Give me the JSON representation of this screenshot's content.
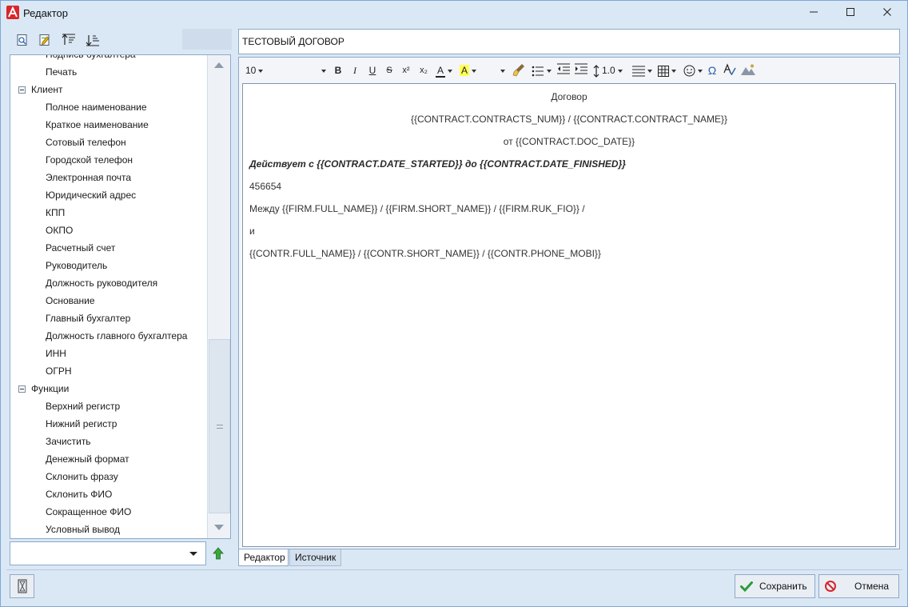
{
  "window": {
    "title": "Редактор",
    "colors": {
      "frame": "#dae8f5",
      "border": "#7ea7d6",
      "app_icon": "#d8262c"
    }
  },
  "left_toolbar": {
    "icons": [
      "preview-icon",
      "edit-icon",
      "sort-up-icon",
      "sort-down-icon"
    ]
  },
  "tree": {
    "items": [
      {
        "label": "Подпись бухгалтера",
        "level": 1
      },
      {
        "label": "Печать",
        "level": 1
      },
      {
        "label": "Клиент",
        "level": 0,
        "expanded": true
      },
      {
        "label": "Полное наименование",
        "level": 1
      },
      {
        "label": "Краткое наименование",
        "level": 1
      },
      {
        "label": "Сотовый телефон",
        "level": 1
      },
      {
        "label": "Городской телефон",
        "level": 1
      },
      {
        "label": "Электронная почта",
        "level": 1
      },
      {
        "label": "Юридический адрес",
        "level": 1
      },
      {
        "label": "КПП",
        "level": 1
      },
      {
        "label": "ОКПО",
        "level": 1
      },
      {
        "label": "Расчетный счет",
        "level": 1
      },
      {
        "label": "Руководитель",
        "level": 1
      },
      {
        "label": "Должность руководителя",
        "level": 1
      },
      {
        "label": "Основание",
        "level": 1
      },
      {
        "label": "Главный бухгалтер",
        "level": 1
      },
      {
        "label": "Должность главного бухгалтера",
        "level": 1
      },
      {
        "label": "ИНН",
        "level": 1
      },
      {
        "label": "ОГРН",
        "level": 1
      },
      {
        "label": "Функции",
        "level": 0,
        "expanded": true
      },
      {
        "label": "Верхний регистр",
        "level": 1
      },
      {
        "label": "Нижний регистр",
        "level": 1
      },
      {
        "label": "Зачистить",
        "level": 1
      },
      {
        "label": "Денежный формат",
        "level": 1
      },
      {
        "label": "Склонить фразу",
        "level": 1
      },
      {
        "label": "Склонить ФИО",
        "level": 1
      },
      {
        "label": "Сокращенное ФИО",
        "level": 1
      },
      {
        "label": "Условный вывод",
        "level": 1
      }
    ]
  },
  "combo": {
    "value": ""
  },
  "document_title": {
    "value": "ТЕСТОВЫЙ ДОГОВОР"
  },
  "toolbar": {
    "font_size": "10",
    "bold": "B",
    "italic": "I",
    "underline": "U",
    "strike": "S",
    "superscript": "x²",
    "subscript": "x₂",
    "font_color": "A",
    "highlight": "A",
    "line_spacing": "1.0",
    "omega": "Ω"
  },
  "document": {
    "lines": [
      {
        "text": "Договор",
        "style": "center"
      },
      {
        "text": "{{CONTRACT.CONTRACTS_NUM}} / {{CONTRACT.CONTRACT_NAME}}",
        "style": "center"
      },
      {
        "text": "от {{CONTRACT.DOC_DATE}}",
        "style": "center"
      },
      {
        "text": "Действует с {{CONTRACT.DATE_STARTED}} до {{CONTRACT.DATE_FINISHED}}",
        "style": "bold-italic"
      },
      {
        "text": "456654",
        "style": "normal"
      },
      {
        "text": "Между {{FIRM.FULL_NAME}} / {{FIRM.SHORT_NAME}} / {{FIRM.RUK_FIO}} /",
        "style": "normal"
      },
      {
        "text": "и",
        "style": "normal"
      },
      {
        "text": "{{CONTR.FULL_NAME}}  / {{CONTR.SHORT_NAME}} / {{CONTR.PHONE_MOBI}}",
        "style": "normal"
      }
    ]
  },
  "tabs": [
    {
      "label": "Редактор",
      "active": true
    },
    {
      "label": "Источник",
      "active": false
    }
  ],
  "buttons": {
    "save": "Сохранить",
    "cancel": "Отмена"
  }
}
